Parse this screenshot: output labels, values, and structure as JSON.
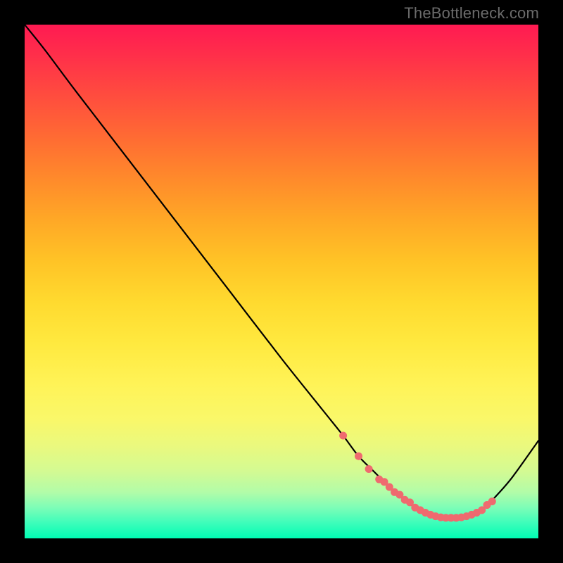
{
  "watermark": "TheBottleneck.com",
  "chart_data": {
    "type": "line",
    "title": "",
    "xlabel": "",
    "ylabel": "",
    "xlim": [
      0,
      100
    ],
    "ylim": [
      0,
      100
    ],
    "series": [
      {
        "name": "curve",
        "x": [
          0,
          4,
          10,
          20,
          30,
          40,
          50,
          58,
          62,
          65,
          68,
          70,
          72,
          74,
          76,
          78,
          80,
          82,
          84,
          86,
          88,
          90,
          92,
          95,
          100
        ],
        "values": [
          100,
          95,
          87,
          74,
          61,
          48,
          35,
          25,
          20,
          16,
          13,
          11,
          9,
          7.5,
          6,
          5,
          4.3,
          4,
          4,
          4.3,
          5,
          6.5,
          8.5,
          12,
          19
        ]
      }
    ],
    "markers": {
      "name": "dots",
      "color": "#ef6a6f",
      "x": [
        62,
        65,
        67,
        69,
        70,
        71,
        72,
        73,
        74,
        75,
        76,
        77,
        78,
        79,
        80,
        81,
        82,
        83,
        84,
        85,
        86,
        87,
        88,
        89,
        90,
        91
      ],
      "values": [
        20,
        16,
        13.5,
        11.5,
        11,
        10,
        9,
        8.5,
        7.5,
        7,
        6,
        5.5,
        5,
        4.6,
        4.3,
        4.1,
        4,
        4,
        4,
        4.1,
        4.3,
        4.6,
        5,
        5.5,
        6.5,
        7.2
      ]
    }
  }
}
